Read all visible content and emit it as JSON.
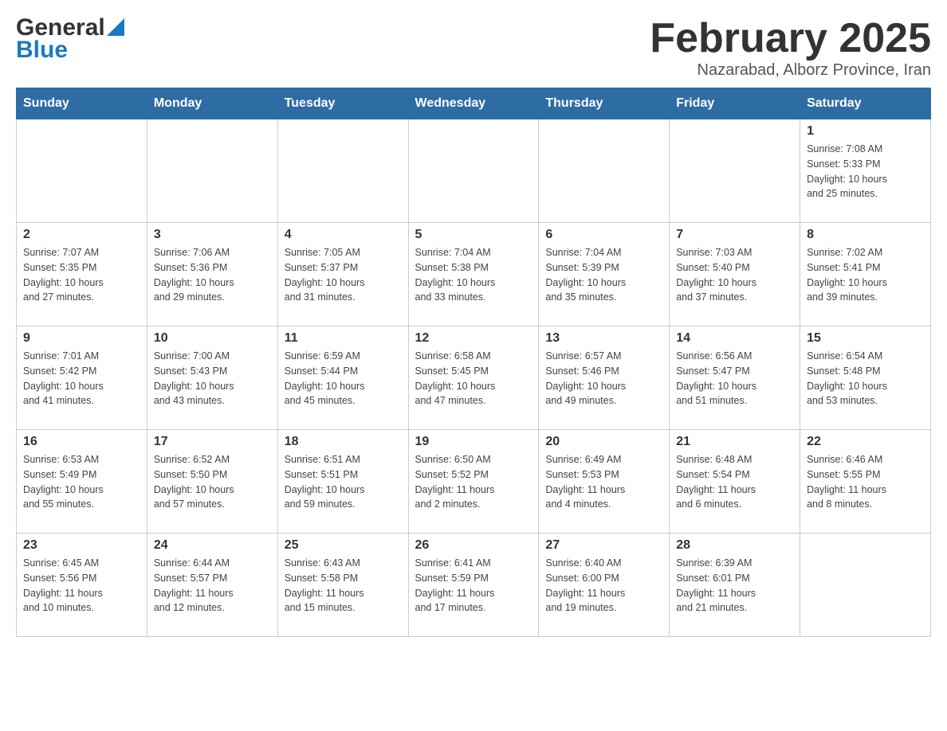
{
  "logo": {
    "general": "General",
    "blue": "Blue",
    "triangle_color": "#1a7abf"
  },
  "header": {
    "title": "February 2025",
    "location": "Nazarabad, Alborz Province, Iran"
  },
  "weekdays": [
    "Sunday",
    "Monday",
    "Tuesday",
    "Wednesday",
    "Thursday",
    "Friday",
    "Saturday"
  ],
  "weeks": [
    {
      "days": [
        {
          "date": "",
          "info": ""
        },
        {
          "date": "",
          "info": ""
        },
        {
          "date": "",
          "info": ""
        },
        {
          "date": "",
          "info": ""
        },
        {
          "date": "",
          "info": ""
        },
        {
          "date": "",
          "info": ""
        },
        {
          "date": "1",
          "info": "Sunrise: 7:08 AM\nSunset: 5:33 PM\nDaylight: 10 hours\nand 25 minutes."
        }
      ]
    },
    {
      "days": [
        {
          "date": "2",
          "info": "Sunrise: 7:07 AM\nSunset: 5:35 PM\nDaylight: 10 hours\nand 27 minutes."
        },
        {
          "date": "3",
          "info": "Sunrise: 7:06 AM\nSunset: 5:36 PM\nDaylight: 10 hours\nand 29 minutes."
        },
        {
          "date": "4",
          "info": "Sunrise: 7:05 AM\nSunset: 5:37 PM\nDaylight: 10 hours\nand 31 minutes."
        },
        {
          "date": "5",
          "info": "Sunrise: 7:04 AM\nSunset: 5:38 PM\nDaylight: 10 hours\nand 33 minutes."
        },
        {
          "date": "6",
          "info": "Sunrise: 7:04 AM\nSunset: 5:39 PM\nDaylight: 10 hours\nand 35 minutes."
        },
        {
          "date": "7",
          "info": "Sunrise: 7:03 AM\nSunset: 5:40 PM\nDaylight: 10 hours\nand 37 minutes."
        },
        {
          "date": "8",
          "info": "Sunrise: 7:02 AM\nSunset: 5:41 PM\nDaylight: 10 hours\nand 39 minutes."
        }
      ]
    },
    {
      "days": [
        {
          "date": "9",
          "info": "Sunrise: 7:01 AM\nSunset: 5:42 PM\nDaylight: 10 hours\nand 41 minutes."
        },
        {
          "date": "10",
          "info": "Sunrise: 7:00 AM\nSunset: 5:43 PM\nDaylight: 10 hours\nand 43 minutes."
        },
        {
          "date": "11",
          "info": "Sunrise: 6:59 AM\nSunset: 5:44 PM\nDaylight: 10 hours\nand 45 minutes."
        },
        {
          "date": "12",
          "info": "Sunrise: 6:58 AM\nSunset: 5:45 PM\nDaylight: 10 hours\nand 47 minutes."
        },
        {
          "date": "13",
          "info": "Sunrise: 6:57 AM\nSunset: 5:46 PM\nDaylight: 10 hours\nand 49 minutes."
        },
        {
          "date": "14",
          "info": "Sunrise: 6:56 AM\nSunset: 5:47 PM\nDaylight: 10 hours\nand 51 minutes."
        },
        {
          "date": "15",
          "info": "Sunrise: 6:54 AM\nSunset: 5:48 PM\nDaylight: 10 hours\nand 53 minutes."
        }
      ]
    },
    {
      "days": [
        {
          "date": "16",
          "info": "Sunrise: 6:53 AM\nSunset: 5:49 PM\nDaylight: 10 hours\nand 55 minutes."
        },
        {
          "date": "17",
          "info": "Sunrise: 6:52 AM\nSunset: 5:50 PM\nDaylight: 10 hours\nand 57 minutes."
        },
        {
          "date": "18",
          "info": "Sunrise: 6:51 AM\nSunset: 5:51 PM\nDaylight: 10 hours\nand 59 minutes."
        },
        {
          "date": "19",
          "info": "Sunrise: 6:50 AM\nSunset: 5:52 PM\nDaylight: 11 hours\nand 2 minutes."
        },
        {
          "date": "20",
          "info": "Sunrise: 6:49 AM\nSunset: 5:53 PM\nDaylight: 11 hours\nand 4 minutes."
        },
        {
          "date": "21",
          "info": "Sunrise: 6:48 AM\nSunset: 5:54 PM\nDaylight: 11 hours\nand 6 minutes."
        },
        {
          "date": "22",
          "info": "Sunrise: 6:46 AM\nSunset: 5:55 PM\nDaylight: 11 hours\nand 8 minutes."
        }
      ]
    },
    {
      "days": [
        {
          "date": "23",
          "info": "Sunrise: 6:45 AM\nSunset: 5:56 PM\nDaylight: 11 hours\nand 10 minutes."
        },
        {
          "date": "24",
          "info": "Sunrise: 6:44 AM\nSunset: 5:57 PM\nDaylight: 11 hours\nand 12 minutes."
        },
        {
          "date": "25",
          "info": "Sunrise: 6:43 AM\nSunset: 5:58 PM\nDaylight: 11 hours\nand 15 minutes."
        },
        {
          "date": "26",
          "info": "Sunrise: 6:41 AM\nSunset: 5:59 PM\nDaylight: 11 hours\nand 17 minutes."
        },
        {
          "date": "27",
          "info": "Sunrise: 6:40 AM\nSunset: 6:00 PM\nDaylight: 11 hours\nand 19 minutes."
        },
        {
          "date": "28",
          "info": "Sunrise: 6:39 AM\nSunset: 6:01 PM\nDaylight: 11 hours\nand 21 minutes."
        },
        {
          "date": "",
          "info": ""
        }
      ]
    }
  ]
}
